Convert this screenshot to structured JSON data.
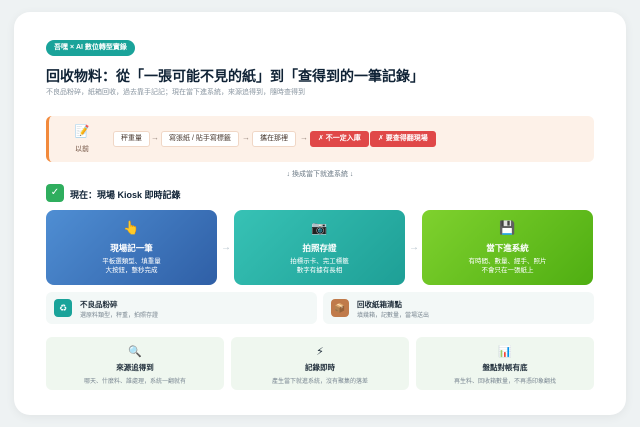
{
  "tag": "吾嘿 × AI 數位轉型實錄",
  "title": "回收物料：從「一張可能不見的紙」到「查得到的一筆記錄」",
  "subtitle": "不良品粉碎，紙箱回收，過去靠手記記；現在當下進系統，來源追得到，隨時查得到",
  "before": {
    "icon": "document-icon",
    "label": "以前",
    "chips": [
      "秤重量",
      "寫張紙 / 貼手寫標籤",
      "攜在那裡",
      "✗ 不一定入庫",
      "✗ 要查得翻現場"
    ]
  },
  "transition": "↓ 換成當下就進系統 ↓",
  "now_title": "現在：現場 Kiosk 即時記錄",
  "steps": [
    {
      "icon": "👆",
      "title": "現場記一筆",
      "lines": [
        "平板選類型、填重量",
        "大按鈕，整秒完成"
      ],
      "color": "#3a73b8"
    },
    {
      "icon": "📷",
      "title": "拍照存證",
      "lines": [
        "拍標示卡、完工標籤",
        "數字有據有長相"
      ],
      "color": "#23b3a8"
    },
    {
      "icon": "💾",
      "title": "當下進系統",
      "lines": [
        "有時間、數量、經手、照片",
        "不會只在一張紙上"
      ],
      "color": "#5fbf1d"
    }
  ],
  "minis": [
    {
      "icon": "♻",
      "title": "不良品粉碎",
      "line": "選原料類型，秤重，拍照存證",
      "color": "#1aa39a"
    },
    {
      "icon": "📦",
      "title": "回收紙箱清點",
      "line": "填幾箱，記數量，當場送出",
      "color": "#c07a4a"
    }
  ],
  "bottoms": [
    {
      "icon": "🔍",
      "title": "來源追得到",
      "line": "哪天、什麼料、誰處理，系統一翻就有"
    },
    {
      "icon": "⚡",
      "title": "記錄即時",
      "line": "產生當下就進系統，沒有聚集的落差"
    },
    {
      "icon": "📊",
      "title": "盤點對帳有底",
      "line": "再生料、回收箱數量，不再憑印象翻找"
    }
  ]
}
